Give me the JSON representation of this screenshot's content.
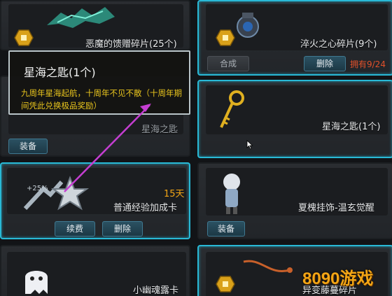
{
  "colors": {
    "accent_cyan": "#29b9d6",
    "gold_text": "#e9c51d",
    "red_text": "#e0502a",
    "orange_text": "#f2a515",
    "annotation_arrow": "#c43ed1"
  },
  "cards": {
    "demon_gift": {
      "name": "恶魔的馈赠碎片(25个)",
      "badge_icon": "gold-crown-badge-icon",
      "art_icon": "demon-wing-fragment-icon"
    },
    "quench_heart": {
      "name": "淬火之心碎片(9个)",
      "badge_icon": "gold-crown-badge-icon",
      "art_icon": "gear-heart-icon",
      "compose_label": "合成",
      "delete_label": "删除",
      "owned": "拥有9/24"
    },
    "left_middle": {
      "name_partial": "星海之匙",
      "equip_label": "装备"
    },
    "star_key": {
      "name": "星海之匙(1个)",
      "art_icon": "golden-key-icon"
    },
    "exp_card": {
      "name": "普通经验加成卡",
      "duration": "15天",
      "renew_label": "续费",
      "delete_label": "删除",
      "art_icon": "silver-star-exp-icon",
      "art_badge": "+25%"
    },
    "pendant": {
      "name": "夏槐挂饰-温玄觉醒",
      "equip_label": "装备",
      "art_icon": "chibi-doll-icon"
    },
    "ghost_card": {
      "name": "小幽魂露卡",
      "art_icon": "ghost-icon"
    },
    "mutant_vine": {
      "name": "异变藤蔓碎片",
      "badge_icon": "gold-crown-badge-icon",
      "art_icon": "vine-fragment-icon"
    }
  },
  "tooltip": {
    "title": "星海之匙(1个)",
    "description": "九周年星海起航，十周年不见不散（十周年期间凭此兑换极品奖励）"
  },
  "watermark": {
    "text": "8090游戏"
  }
}
